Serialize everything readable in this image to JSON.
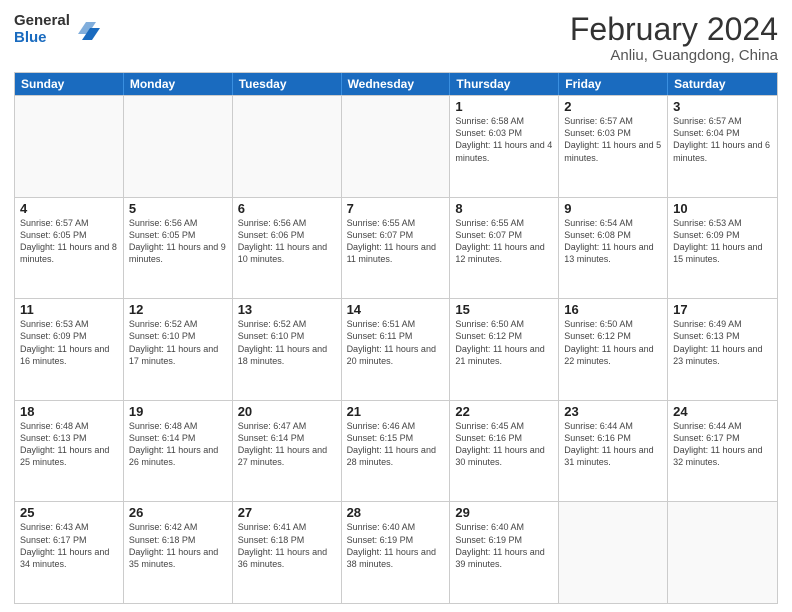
{
  "header": {
    "logo_line1": "General",
    "logo_line2": "Blue",
    "title": "February 2024",
    "subtitle": "Anliu, Guangdong, China"
  },
  "days_of_week": [
    "Sunday",
    "Monday",
    "Tuesday",
    "Wednesday",
    "Thursday",
    "Friday",
    "Saturday"
  ],
  "weeks": [
    [
      {
        "num": "",
        "info": ""
      },
      {
        "num": "",
        "info": ""
      },
      {
        "num": "",
        "info": ""
      },
      {
        "num": "",
        "info": ""
      },
      {
        "num": "1",
        "info": "Sunrise: 6:58 AM\nSunset: 6:03 PM\nDaylight: 11 hours and 4 minutes."
      },
      {
        "num": "2",
        "info": "Sunrise: 6:57 AM\nSunset: 6:03 PM\nDaylight: 11 hours and 5 minutes."
      },
      {
        "num": "3",
        "info": "Sunrise: 6:57 AM\nSunset: 6:04 PM\nDaylight: 11 hours and 6 minutes."
      }
    ],
    [
      {
        "num": "4",
        "info": "Sunrise: 6:57 AM\nSunset: 6:05 PM\nDaylight: 11 hours and 8 minutes."
      },
      {
        "num": "5",
        "info": "Sunrise: 6:56 AM\nSunset: 6:05 PM\nDaylight: 11 hours and 9 minutes."
      },
      {
        "num": "6",
        "info": "Sunrise: 6:56 AM\nSunset: 6:06 PM\nDaylight: 11 hours and 10 minutes."
      },
      {
        "num": "7",
        "info": "Sunrise: 6:55 AM\nSunset: 6:07 PM\nDaylight: 11 hours and 11 minutes."
      },
      {
        "num": "8",
        "info": "Sunrise: 6:55 AM\nSunset: 6:07 PM\nDaylight: 11 hours and 12 minutes."
      },
      {
        "num": "9",
        "info": "Sunrise: 6:54 AM\nSunset: 6:08 PM\nDaylight: 11 hours and 13 minutes."
      },
      {
        "num": "10",
        "info": "Sunrise: 6:53 AM\nSunset: 6:09 PM\nDaylight: 11 hours and 15 minutes."
      }
    ],
    [
      {
        "num": "11",
        "info": "Sunrise: 6:53 AM\nSunset: 6:09 PM\nDaylight: 11 hours and 16 minutes."
      },
      {
        "num": "12",
        "info": "Sunrise: 6:52 AM\nSunset: 6:10 PM\nDaylight: 11 hours and 17 minutes."
      },
      {
        "num": "13",
        "info": "Sunrise: 6:52 AM\nSunset: 6:10 PM\nDaylight: 11 hours and 18 minutes."
      },
      {
        "num": "14",
        "info": "Sunrise: 6:51 AM\nSunset: 6:11 PM\nDaylight: 11 hours and 20 minutes."
      },
      {
        "num": "15",
        "info": "Sunrise: 6:50 AM\nSunset: 6:12 PM\nDaylight: 11 hours and 21 minutes."
      },
      {
        "num": "16",
        "info": "Sunrise: 6:50 AM\nSunset: 6:12 PM\nDaylight: 11 hours and 22 minutes."
      },
      {
        "num": "17",
        "info": "Sunrise: 6:49 AM\nSunset: 6:13 PM\nDaylight: 11 hours and 23 minutes."
      }
    ],
    [
      {
        "num": "18",
        "info": "Sunrise: 6:48 AM\nSunset: 6:13 PM\nDaylight: 11 hours and 25 minutes."
      },
      {
        "num": "19",
        "info": "Sunrise: 6:48 AM\nSunset: 6:14 PM\nDaylight: 11 hours and 26 minutes."
      },
      {
        "num": "20",
        "info": "Sunrise: 6:47 AM\nSunset: 6:14 PM\nDaylight: 11 hours and 27 minutes."
      },
      {
        "num": "21",
        "info": "Sunrise: 6:46 AM\nSunset: 6:15 PM\nDaylight: 11 hours and 28 minutes."
      },
      {
        "num": "22",
        "info": "Sunrise: 6:45 AM\nSunset: 6:16 PM\nDaylight: 11 hours and 30 minutes."
      },
      {
        "num": "23",
        "info": "Sunrise: 6:44 AM\nSunset: 6:16 PM\nDaylight: 11 hours and 31 minutes."
      },
      {
        "num": "24",
        "info": "Sunrise: 6:44 AM\nSunset: 6:17 PM\nDaylight: 11 hours and 32 minutes."
      }
    ],
    [
      {
        "num": "25",
        "info": "Sunrise: 6:43 AM\nSunset: 6:17 PM\nDaylight: 11 hours and 34 minutes."
      },
      {
        "num": "26",
        "info": "Sunrise: 6:42 AM\nSunset: 6:18 PM\nDaylight: 11 hours and 35 minutes."
      },
      {
        "num": "27",
        "info": "Sunrise: 6:41 AM\nSunset: 6:18 PM\nDaylight: 11 hours and 36 minutes."
      },
      {
        "num": "28",
        "info": "Sunrise: 6:40 AM\nSunset: 6:19 PM\nDaylight: 11 hours and 38 minutes."
      },
      {
        "num": "29",
        "info": "Sunrise: 6:40 AM\nSunset: 6:19 PM\nDaylight: 11 hours and 39 minutes."
      },
      {
        "num": "",
        "info": ""
      },
      {
        "num": "",
        "info": ""
      }
    ]
  ]
}
